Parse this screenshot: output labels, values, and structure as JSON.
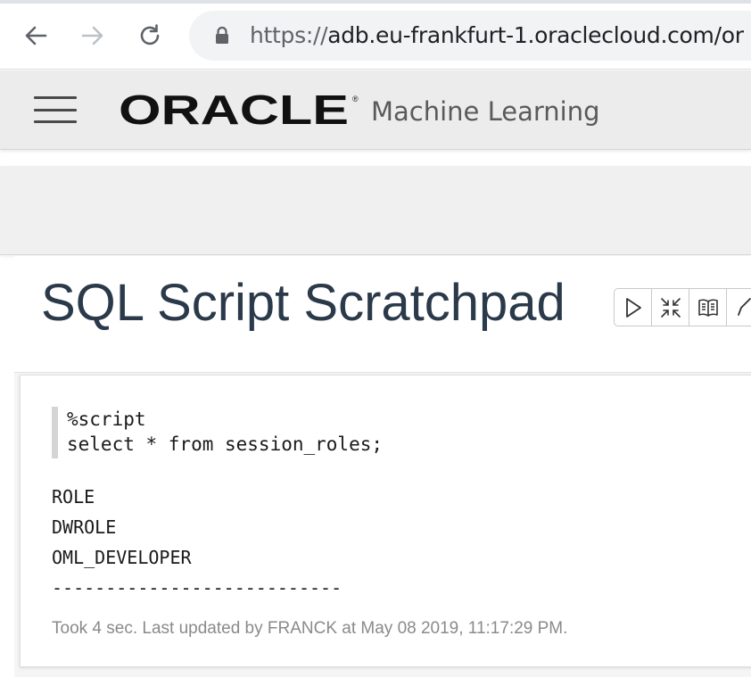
{
  "browser": {
    "url_scheme": "https://",
    "url_rest": "adb.eu-frankfurt-1.oraclecloud.com/or",
    "icons": [
      "back-arrow-icon",
      "forward-arrow-icon",
      "reload-icon",
      "lock-icon"
    ]
  },
  "app": {
    "brand": "ORACLE",
    "product": "Machine Learning",
    "menu_icon": "hamburger-menu-icon"
  },
  "notebook": {
    "title": "SQL Script Scratchpad",
    "toolbar_icons": [
      "run-icon",
      "collapse-icon",
      "book-icon",
      "edit-icon"
    ]
  },
  "paragraph": {
    "code": [
      "%script",
      "select * from session_roles;"
    ],
    "result": [
      "ROLE",
      "DWROLE",
      "OML_DEVELOPER",
      "---------------------------"
    ],
    "status": "Took 4 sec. Last updated by FRANCK at May 08 2019, 11:17:29 PM."
  },
  "colors": {
    "title": "#2b3a4a",
    "header_bg": "#ececec",
    "address_bg": "#f1f3f4"
  }
}
